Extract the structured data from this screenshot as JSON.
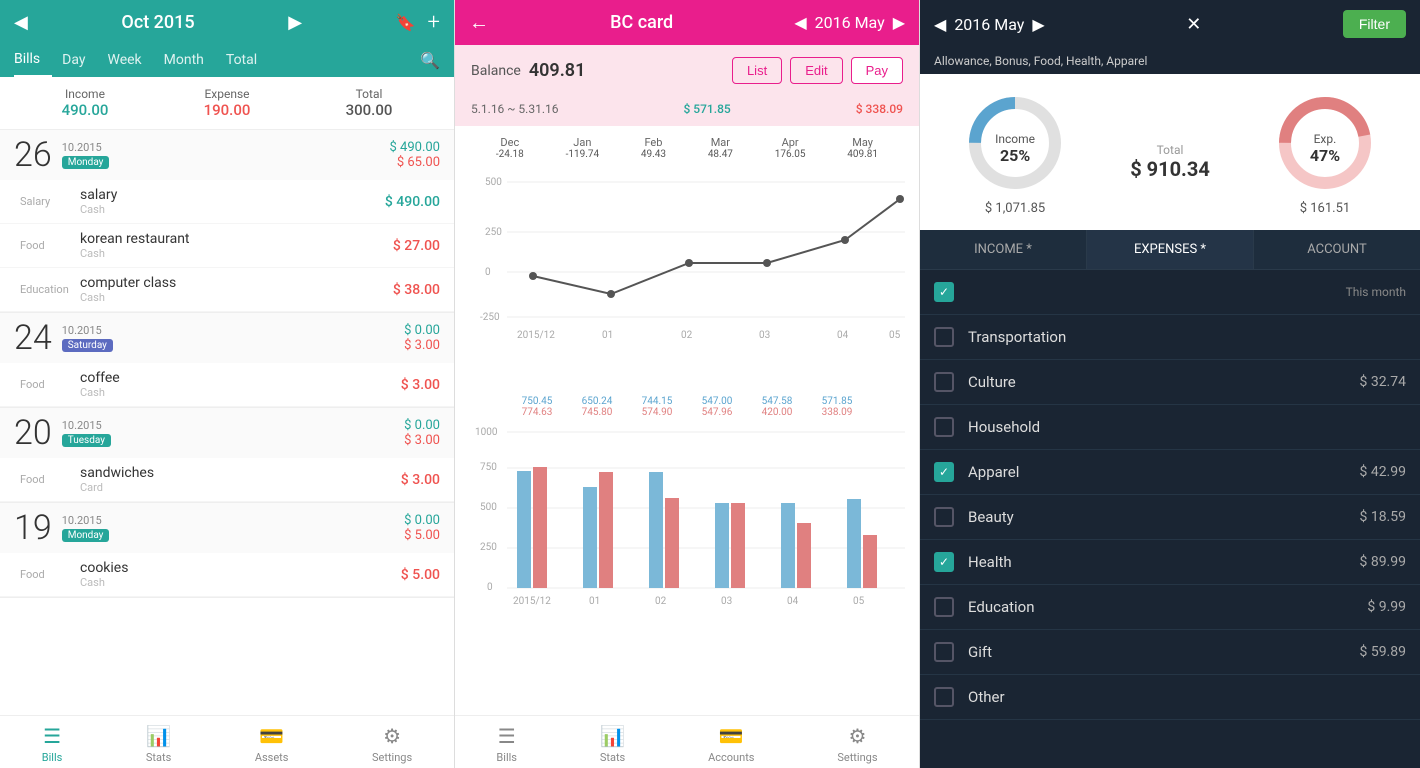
{
  "panel1": {
    "header": {
      "prev_icon": "◀",
      "title": "Oct 2015",
      "next_icon": "▶",
      "bookmark_icon": "🔖",
      "add_icon": "+"
    },
    "tabs": [
      {
        "label": "Bills",
        "active": true
      },
      {
        "label": "Day",
        "active": false
      },
      {
        "label": "Week",
        "active": false
      },
      {
        "label": "Month",
        "active": false
      },
      {
        "label": "Total",
        "active": false
      }
    ],
    "summary": {
      "income_label": "Income",
      "income_value": "490.00",
      "expense_label": "Expense",
      "expense_value": "190.00",
      "total_label": "Total",
      "total_value": "300.00"
    },
    "days": [
      {
        "number": "26",
        "date": "10.2015",
        "badge": "Monday",
        "badge_class": "badge-monday",
        "income": "$ 490.00",
        "expense": "$ 65.00",
        "transactions": [
          {
            "category": "Salary",
            "name": "salary",
            "method": "Cash",
            "amount": "$ 490.00",
            "type": "income"
          },
          {
            "category": "Food",
            "name": "korean restaurant",
            "method": "Cash",
            "amount": "$ 27.00",
            "type": "expense"
          },
          {
            "category": "Education",
            "name": "computer class",
            "method": "Cash",
            "amount": "$ 38.00",
            "type": "expense"
          }
        ]
      },
      {
        "number": "24",
        "date": "10.2015",
        "badge": "Saturday",
        "badge_class": "badge-saturday",
        "income": "$ 0.00",
        "expense": "$ 3.00",
        "transactions": [
          {
            "category": "Food",
            "name": "coffee",
            "method": "Cash",
            "amount": "$ 3.00",
            "type": "expense"
          }
        ]
      },
      {
        "number": "20",
        "date": "10.2015",
        "badge": "Tuesday",
        "badge_class": "badge-tuesday",
        "income": "$ 0.00",
        "expense": "$ 3.00",
        "transactions": [
          {
            "category": "Food",
            "name": "sandwiches",
            "method": "Card",
            "amount": "$ 3.00",
            "type": "expense"
          }
        ]
      },
      {
        "number": "19",
        "date": "10.2015",
        "badge": "Monday",
        "badge_class": "badge-monday",
        "income": "$ 0.00",
        "expense": "$ 5.00",
        "transactions": [
          {
            "category": "Food",
            "name": "cookies",
            "method": "Cash",
            "amount": "$ 5.00",
            "type": "expense"
          }
        ]
      }
    ],
    "footer": [
      {
        "label": "Bills",
        "icon": "☰",
        "active": true
      },
      {
        "label": "Stats",
        "icon": "📊",
        "active": false
      },
      {
        "label": "Assets",
        "icon": "💳",
        "active": false
      },
      {
        "label": "Settings",
        "icon": "⚙",
        "active": false
      }
    ]
  },
  "panel2": {
    "header": {
      "back_icon": "←",
      "title": "BC card",
      "prev_icon": "◀",
      "date": "2016 May",
      "next_icon": "▶"
    },
    "balance": {
      "label": "Balance",
      "value": "409.81",
      "btn_list": "List",
      "btn_edit": "Edit",
      "btn_pay": "Pay"
    },
    "period": {
      "range": "5.1.16  ~  5.31.16",
      "income": "$ 571.85",
      "expense": "$ 338.09"
    },
    "line_chart": {
      "months": [
        {
          "label": "Dec",
          "val": "-24.18"
        },
        {
          "label": "Jan",
          "val": "-119.74"
        },
        {
          "label": "Feb",
          "val": "49.43"
        },
        {
          "label": "Mar",
          "val": "48.47"
        },
        {
          "label": "Apr",
          "val": "176.05"
        },
        {
          "label": "May",
          "val": "409.81"
        }
      ],
      "x_labels": [
        "2015/12",
        "01",
        "02",
        "03",
        "04",
        "05"
      ],
      "y_labels": [
        "500",
        "250",
        "0",
        "-250"
      ]
    },
    "bar_chart": {
      "months": [
        {
          "label": "2015/12",
          "income": 750,
          "expense": 774,
          "income_label": "750.45",
          "expense_label": "774.63"
        },
        {
          "label": "01",
          "income": 650,
          "expense": 745,
          "income_label": "650.24",
          "expense_label": "745.80"
        },
        {
          "label": "02",
          "income": 744,
          "expense": 574,
          "income_label": "744.15",
          "expense_label": "574.90"
        },
        {
          "label": "03",
          "income": 547,
          "expense": 547,
          "income_label": "547.00",
          "expense_label": "547.96"
        },
        {
          "label": "04",
          "income": 547,
          "expense": 420,
          "income_label": "547.58",
          "expense_label": "420.00"
        },
        {
          "label": "05",
          "income": 571,
          "expense": 338,
          "income_label": "571.85",
          "expense_label": "338.09"
        }
      ],
      "y_labels": [
        "1000",
        "750",
        "500",
        "250",
        "0"
      ]
    },
    "footer": [
      {
        "label": "Bills",
        "icon": "☰",
        "active": false
      },
      {
        "label": "Stats",
        "icon": "📊",
        "active": false
      },
      {
        "label": "Accounts",
        "icon": "💳",
        "active": false
      },
      {
        "label": "Settings",
        "icon": "⚙",
        "active": false
      }
    ]
  },
  "panel3": {
    "header": {
      "prev_icon": "◀",
      "date": "2016 May",
      "next_icon": "▶",
      "close_icon": "✕",
      "filter_label": "Filter"
    },
    "categories_label": "Allowance, Bonus, Food, Health, Apparel",
    "donut": {
      "income_label": "Income",
      "income_pct": "25%",
      "income_amount": "$ 1,071.85",
      "expense_label": "Exp.",
      "expense_pct": "47%",
      "expense_amount": "$ 161.51",
      "total_label": "Total",
      "total_value": "$ 910.34"
    },
    "tabs": [
      {
        "label": "INCOME *",
        "active": false
      },
      {
        "label": "EXPENSES *",
        "active": true
      },
      {
        "label": "ACCOUNT",
        "active": false
      }
    ],
    "list_header": "This month",
    "items": [
      {
        "name": "Transportation",
        "amount": "",
        "checked": false
      },
      {
        "name": "Culture",
        "amount": "$ 32.74",
        "checked": false
      },
      {
        "name": "Household",
        "amount": "",
        "checked": false
      },
      {
        "name": "Apparel",
        "amount": "$ 42.99",
        "checked": true
      },
      {
        "name": "Beauty",
        "amount": "$ 18.59",
        "checked": false
      },
      {
        "name": "Health",
        "amount": "$ 89.99",
        "checked": true
      },
      {
        "name": "Education",
        "amount": "$ 9.99",
        "checked": false
      },
      {
        "name": "Gift",
        "amount": "$ 59.89",
        "checked": false
      },
      {
        "name": "Other",
        "amount": "",
        "checked": false
      }
    ]
  }
}
